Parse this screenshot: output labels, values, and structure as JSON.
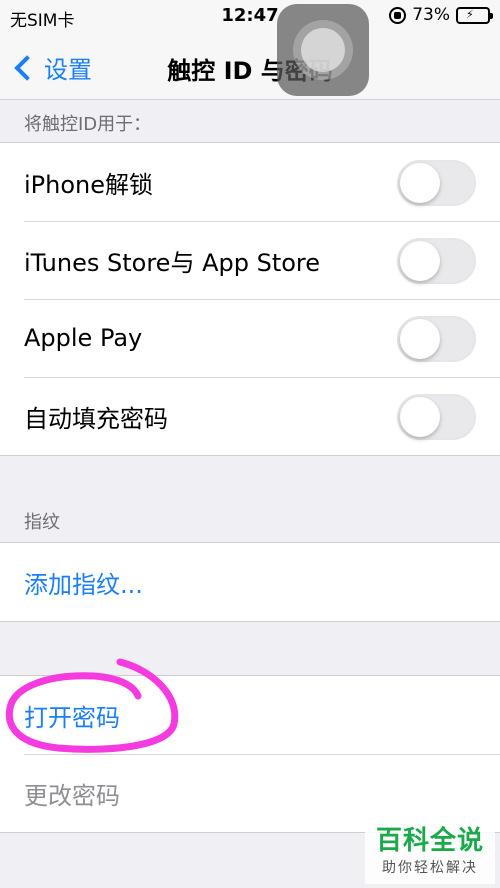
{
  "status_bar": {
    "carrier": "无SIM卡",
    "time": "12:47",
    "battery_percent_label": "73%",
    "battery_level": 0.73,
    "orientation_lock_icon": "orientation-lock-icon",
    "battery_icon": "battery-charging-icon"
  },
  "nav": {
    "back_label": "设置",
    "title": "触控 ID 与密码"
  },
  "touch_id_section": {
    "header": "将触控ID用于：",
    "items": [
      {
        "label": "iPhone解锁",
        "on": false
      },
      {
        "label": "iTunes Store与 App Store",
        "on": false
      },
      {
        "label": "Apple Pay",
        "on": false
      },
      {
        "label": "自动填充密码",
        "on": false
      }
    ]
  },
  "fingerprint_section": {
    "header": "指纹",
    "add_label": "添加指纹..."
  },
  "passcode_section": {
    "turn_on_label": "打开密码",
    "change_label": "更改密码"
  },
  "watermark": {
    "title": "百科全说",
    "subtitle": "助你轻松解决"
  },
  "colors": {
    "accent": "#1a7ff5",
    "annotation": "#f53be0",
    "watermark": "#1aaa4a"
  }
}
